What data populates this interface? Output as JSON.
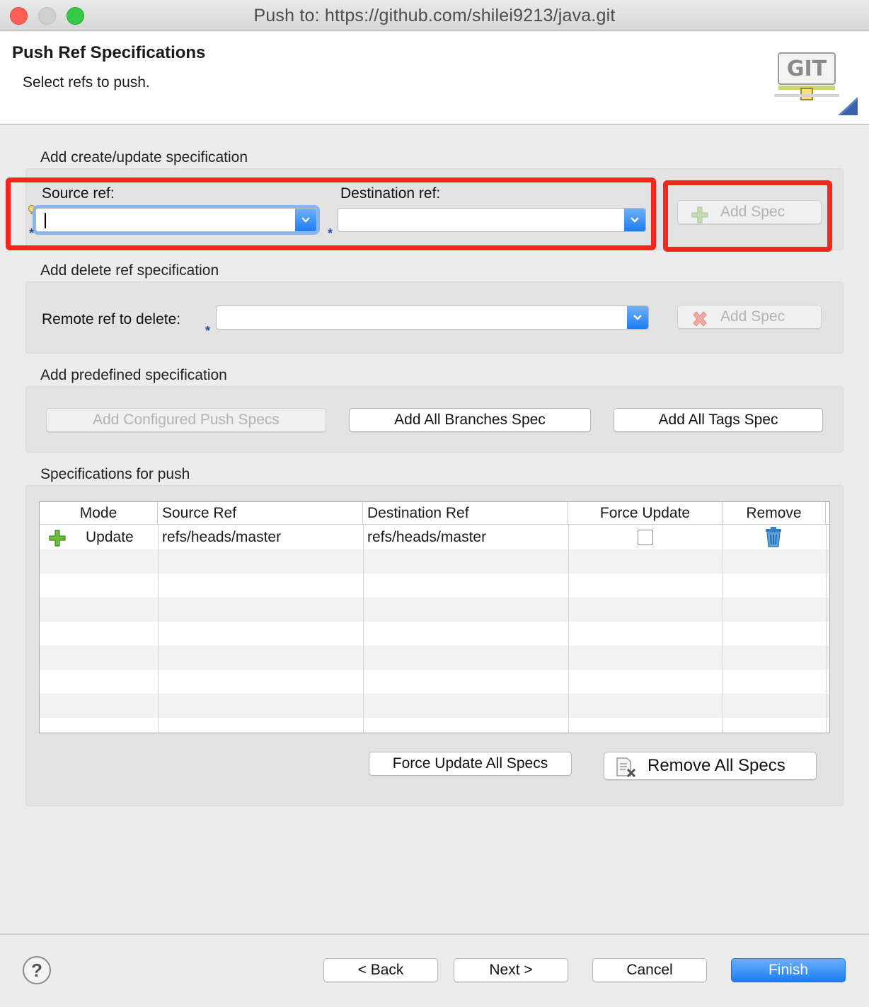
{
  "window": {
    "title": "Push to: https://github.com/shilei9213/java.git"
  },
  "header": {
    "title": "Push Ref Specifications",
    "subtitle": "Select refs to push.",
    "logo_text": "GIT"
  },
  "create_update": {
    "group_label": "Add create/update specification",
    "source_label": "Source ref:",
    "source_value": "",
    "destination_label": "Destination ref:",
    "destination_value": "",
    "add_button": "Add Spec",
    "add_enabled": false
  },
  "delete_ref": {
    "group_label": "Add delete ref specification",
    "remote_label": "Remote ref to delete:",
    "remote_value": "",
    "add_button": "Add Spec",
    "add_enabled": false
  },
  "predefined": {
    "group_label": "Add predefined specification",
    "configured_button": "Add Configured Push Specs",
    "configured_enabled": false,
    "all_branches_button": "Add All Branches Spec",
    "all_tags_button": "Add All Tags Spec"
  },
  "specs": {
    "group_label": "Specifications for push",
    "columns": [
      "Mode",
      "Source Ref",
      "Destination Ref",
      "Force Update",
      "Remove"
    ],
    "rows": [
      {
        "mode": "Update",
        "source_ref": "refs/heads/master",
        "destination_ref": "refs/heads/master",
        "force_update": false,
        "mode_icon": "plus-icon",
        "remove_icon": "trash-icon"
      }
    ],
    "force_update_all_button": "Force Update All Specs",
    "remove_all_button": "Remove All Specs"
  },
  "footer": {
    "help": "?",
    "back": "< Back",
    "next": "Next >",
    "cancel": "Cancel",
    "finish": "Finish"
  },
  "colors": {
    "accent": "#1d7cf2",
    "highlight": "#f2261e",
    "window_bg": "#ececec"
  }
}
